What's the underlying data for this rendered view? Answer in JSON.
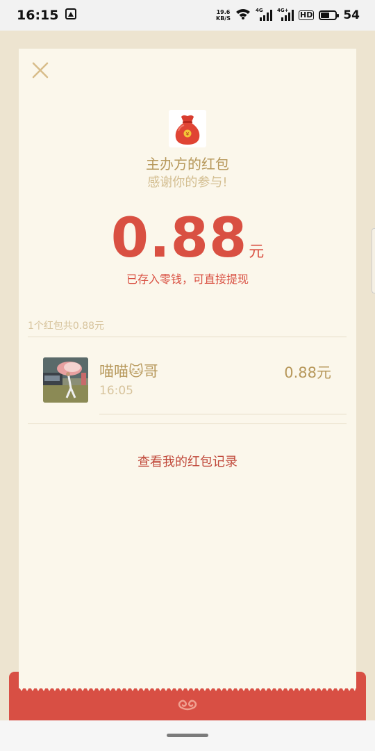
{
  "status_bar": {
    "time": "16:15",
    "net_speed_value": "19.6",
    "net_speed_unit": "KB/S",
    "sim1_label": "4G",
    "sim2_label": "4G+",
    "hd_label": "HD",
    "battery_percent": "54",
    "battery_level": 0.54
  },
  "packet": {
    "sender_title": "主办方的红包",
    "wish_text": "感谢你的参与!",
    "amount": "0.88",
    "amount_unit": "元",
    "saved_note": "已存入零钱，可直接提现"
  },
  "summary": {
    "text": "1个红包共0.88元"
  },
  "entries": [
    {
      "name": "喵喵🐱哥",
      "time": "16:05",
      "amount": "0.88元"
    }
  ],
  "records_link": "查看我的红包记录",
  "colors": {
    "accent_red": "#d95042",
    "gold_text": "#b7985b",
    "light_gold_text": "#d7c49d",
    "card_bg": "#fbf7eb",
    "page_bg": "#ede4d0"
  },
  "icons": {
    "close": "close-icon",
    "bag": "red-money-bag-icon",
    "swirl": "cloud-swirl-icon",
    "wifi": "wifi-icon",
    "signal": "cell-signal-icon",
    "battery": "battery-icon",
    "notification": "notification-square-icon"
  }
}
